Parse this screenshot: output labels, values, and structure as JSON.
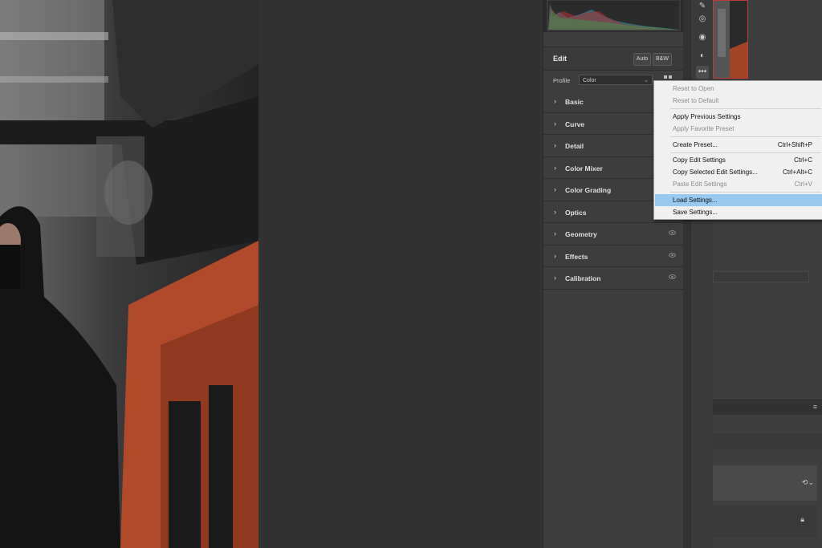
{
  "panel": {
    "title": "Edit",
    "auto_label": "Auto",
    "bw_label": "B&W",
    "profile_label": "Profile",
    "profile_value": "Color",
    "sections": [
      {
        "label": "Basic"
      },
      {
        "label": "Curve"
      },
      {
        "label": "Detail"
      },
      {
        "label": "Color Mixer"
      },
      {
        "label": "Color Grading"
      },
      {
        "label": "Optics"
      },
      {
        "label": "Geometry"
      },
      {
        "label": "Effects"
      },
      {
        "label": "Calibration"
      }
    ]
  },
  "menu": {
    "items": [
      {
        "label": "Reset to Open",
        "shortcut": ""
      },
      {
        "label": "Reset to Default",
        "shortcut": ""
      },
      {
        "label": "Apply Previous Settings",
        "shortcut": ""
      },
      {
        "label": "Apply Favorite Preset",
        "shortcut": ""
      },
      {
        "label": "Create Preset...",
        "shortcut": "Ctrl+Shift+P"
      },
      {
        "label": "Copy Edit Settings",
        "shortcut": "Ctrl+C"
      },
      {
        "label": "Copy Selected Edit Settings...",
        "shortcut": "Ctrl+Alt+C"
      },
      {
        "label": "Paste Edit Settings",
        "shortcut": "Ctrl+V"
      },
      {
        "label": "Load Settings...",
        "shortcut": ""
      },
      {
        "label": "Save Settings...",
        "shortcut": ""
      }
    ]
  },
  "colors": {
    "panel_bg": "#3d3d3d",
    "menu_bg": "#f0f0f0",
    "menu_highlight": "#99c9ef",
    "thumb_border": "#c03a3a"
  },
  "icons": [
    "brush-icon",
    "radial-filter-icon",
    "red-eye-icon",
    "masking-icon",
    "more-icon",
    "profile-grid-icon",
    "chevron-right-icon",
    "eye-icon",
    "lock-icon",
    "sync-icon",
    "panel-menu-icon"
  ]
}
